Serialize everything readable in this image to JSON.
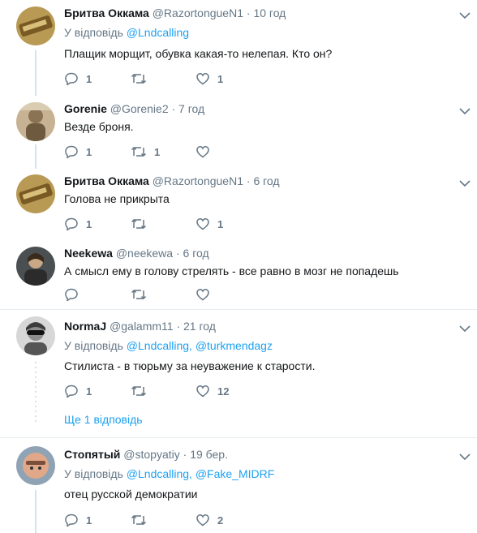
{
  "replies": [
    {
      "name": "Бритва Оккама",
      "handle": "@RazortongueN1",
      "time": "· 10 год",
      "reply_prefix": "У відповідь",
      "reply_to": [
        "@Lndcalling"
      ],
      "text": "Плащик морщит, обувка какая-то нелепая. Кто он?",
      "counts": {
        "reply": "1",
        "retweet": "",
        "like": "1"
      }
    },
    {
      "name": "Gorenie",
      "handle": "@Gorenie2",
      "time": "· 7 год",
      "text": "Везде броня.",
      "counts": {
        "reply": "1",
        "retweet": "1",
        "like": ""
      }
    },
    {
      "name": "Бритва Оккама",
      "handle": "@RazortongueN1",
      "time": "· 6 год",
      "text": "Голова не прикрыта",
      "counts": {
        "reply": "1",
        "retweet": "",
        "like": "1"
      }
    },
    {
      "name": "Neekewa",
      "handle": "@neekewa",
      "time": "· 6 год",
      "text": "А смысл ему в голову стрелять - все равно в мозг не попадешь",
      "counts": {
        "reply": "",
        "retweet": "",
        "like": ""
      }
    },
    {
      "name": "NormaJ",
      "handle": "@galamm11",
      "time": "· 21 год",
      "reply_prefix": "У відповідь",
      "reply_to": [
        "@Lndcalling,",
        "@turkmendagz"
      ],
      "text": "Стилиста - в тюрьму за неуважение к старости.",
      "counts": {
        "reply": "1",
        "retweet": "",
        "like": "12"
      },
      "more_replies": "Ще 1 відповідь"
    },
    {
      "name": "Стопятый",
      "handle": "@stopyatiy",
      "time": "· 19 бер.",
      "reply_prefix": "У відповідь",
      "reply_to": [
        "@Lndcalling,",
        "@Fake_MIDRF"
      ],
      "text": "отец русской демократии",
      "counts": {
        "reply": "1",
        "retweet": "",
        "like": "2"
      }
    }
  ],
  "icons": {
    "reply": "reply-icon",
    "retweet": "retweet-icon",
    "like": "heart-icon",
    "menu": "chevron-down-icon"
  },
  "colors": {
    "link": "#1da1f2",
    "muted": "#657786",
    "thread": "#cfe3f2"
  }
}
